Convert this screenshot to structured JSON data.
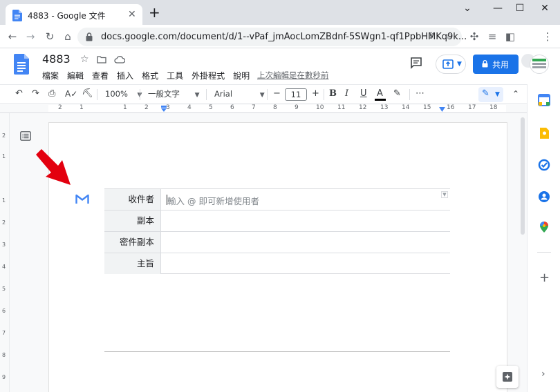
{
  "browser": {
    "tab_title": "4883 - Google 文件",
    "tab_close": "✕",
    "new_tab": "+",
    "url": "docs.google.com/document/d/1--vPaf_jmAocLomZBdnf-5SWgn1-qf1PpbHMKq9k...",
    "window_controls": [
      "⌄",
      "—",
      "☐",
      "✕"
    ]
  },
  "docs": {
    "title": "4883",
    "menu": [
      "檔案",
      "編輯",
      "查看",
      "插入",
      "格式",
      "工具",
      "外掛程式",
      "說明"
    ],
    "last_edit": "上次編輯是在數秒前",
    "share_label": "共用"
  },
  "toolbar": {
    "zoom": "100%",
    "style": "一般文字",
    "font": "Arial",
    "font_size": "11",
    "minus": "−",
    "plus": "+",
    "more": "⋯"
  },
  "ruler": {
    "marks": [
      "2",
      "1",
      "1",
      "2",
      "3",
      "4",
      "5",
      "6",
      "7",
      "8",
      "9",
      "10",
      "11",
      "12",
      "13",
      "14",
      "15",
      "16",
      "17",
      "18"
    ],
    "vmarks": [
      "2",
      "1",
      "1",
      "2",
      "3",
      "4",
      "5",
      "6",
      "7",
      "8",
      "9"
    ]
  },
  "draft": {
    "rows": [
      {
        "label": "收件者",
        "placeholder": "輸入 @ 即可新增使用者"
      },
      {
        "label": "副本"
      },
      {
        "label": "密件副本"
      },
      {
        "label": "主旨"
      }
    ]
  },
  "colors": {
    "accent": "#1a73e8",
    "arrow": "#e3000f",
    "gmail_icon": "#4285f4"
  }
}
